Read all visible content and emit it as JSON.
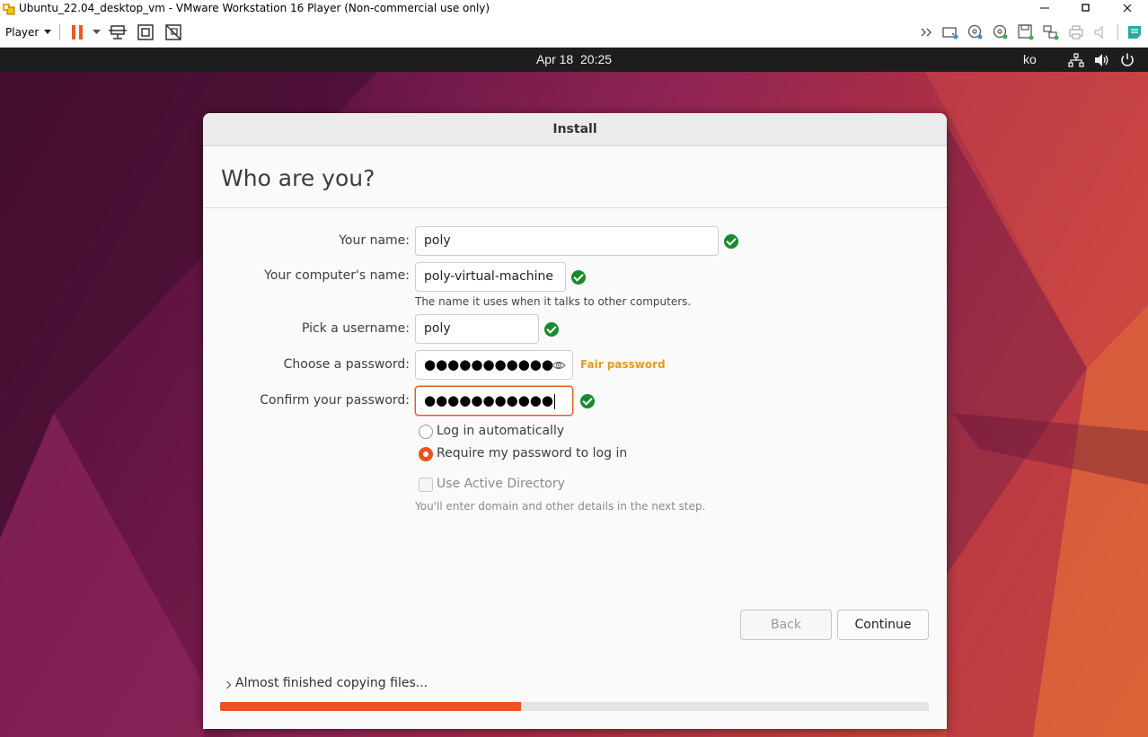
{
  "window": {
    "title": "Ubuntu_22.04_desktop_vm - VMware Workstation 16 Player (Non-commercial use only)",
    "controls": [
      "minimize",
      "maximize",
      "close"
    ]
  },
  "toolbar": {
    "player_label": "Player",
    "left_icons": [
      "pause-icon",
      "dropdown-arrow-icon",
      "send-ctrl-alt-del-icon",
      "fullscreen-icon",
      "unity-icon"
    ],
    "right_icons": [
      "overflow-chevron-icon",
      "hard-disk-icon",
      "cd-dvd-icon",
      "cd-dvd-2-icon",
      "floppy-icon",
      "network-adapter-icon",
      "printer-icon",
      "sound-icon",
      "message-log-icon"
    ]
  },
  "ubuntu_topbar": {
    "date": "Apr 18",
    "time": "20:25",
    "clock": "Apr 18  20:25",
    "language": "ko",
    "icons": [
      "network-icon",
      "volume-icon",
      "power-icon"
    ]
  },
  "installer": {
    "window_title": "Install",
    "heading": "Who are you?",
    "fields": {
      "your_name": {
        "label": "Your name:",
        "value": "poly",
        "valid": true
      },
      "computer_name": {
        "label": "Your computer's name:",
        "value": "poly-virtual-machine",
        "valid": true,
        "hint": "The name it uses when it talks to other computers."
      },
      "username": {
        "label": "Pick a username:",
        "value": "poly",
        "valid": true
      },
      "password": {
        "label": "Choose a password:",
        "masked": "●●●●●●●●●●●",
        "strength": "Fair password"
      },
      "confirm": {
        "label": "Confirm your password:",
        "masked": "●●●●●●●●●●●",
        "valid": true
      }
    },
    "login_options": {
      "auto": {
        "label": "Log in automatically",
        "selected": false
      },
      "require_password": {
        "label": "Require my password to log in",
        "selected": true
      }
    },
    "active_directory": {
      "label": "Use Active Directory",
      "checked": false,
      "enabled": false,
      "hint": "You'll enter domain and other details in the next step."
    },
    "buttons": {
      "back": "Back",
      "continue": "Continue"
    },
    "status": "Almost finished copying files...",
    "progress": 0.425,
    "accent_color": "#e95420",
    "valid_color": "#1a8a2c",
    "strength_color": "#e39d1a"
  }
}
